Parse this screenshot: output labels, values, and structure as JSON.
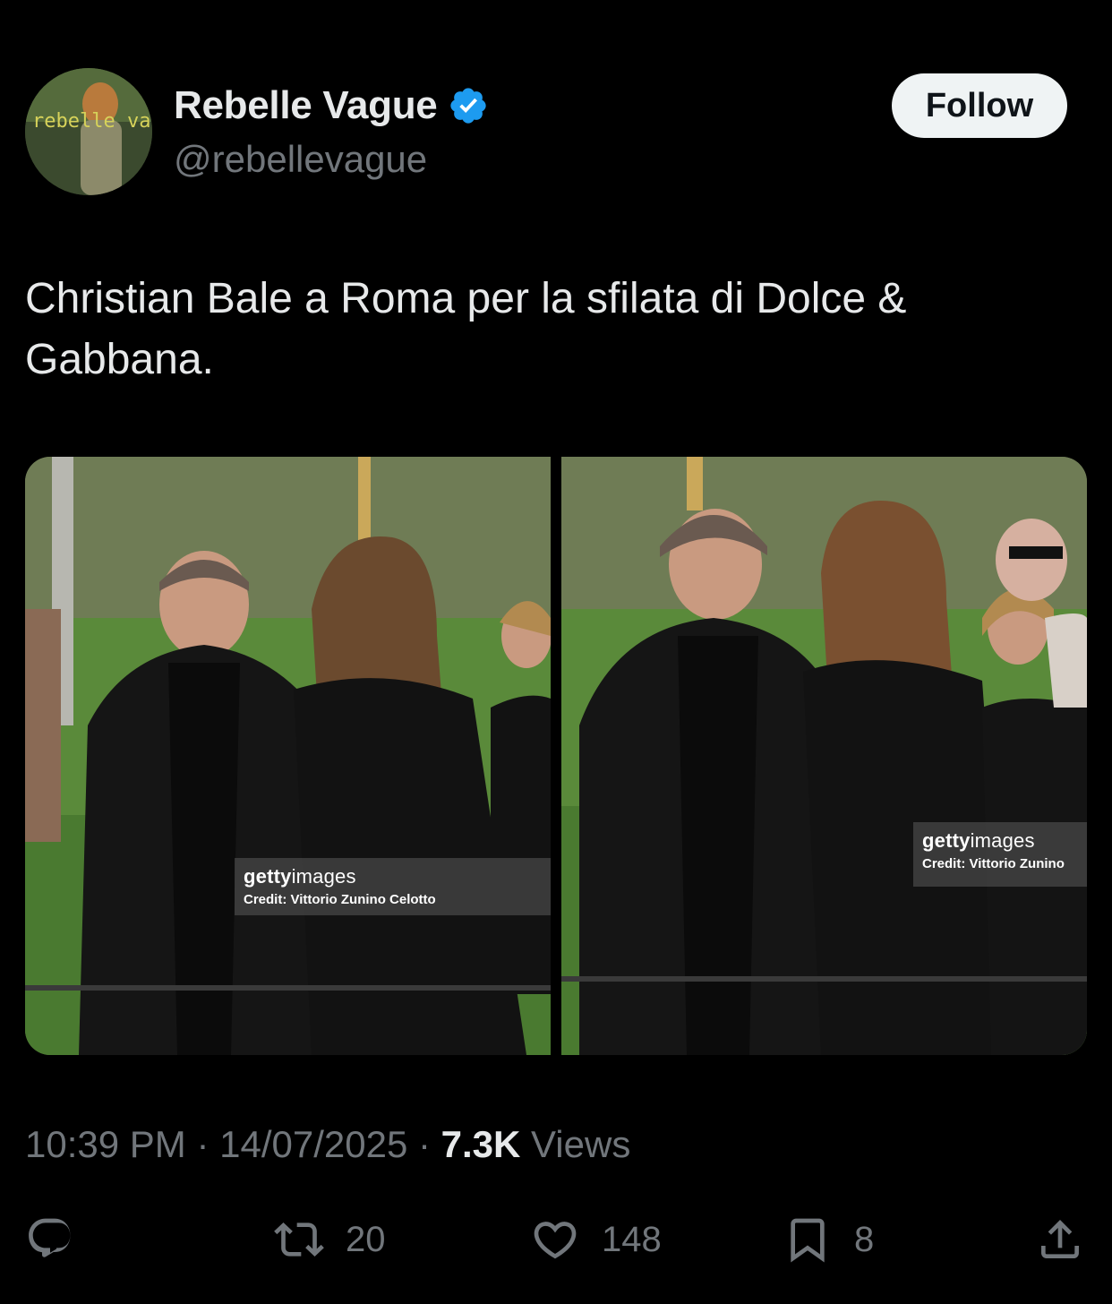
{
  "author": {
    "display_name": "Rebelle Vague",
    "handle": "@rebellevague",
    "avatar_text": "rebelle vague",
    "verified": true
  },
  "follow_label": "Follow",
  "tweet": {
    "text": "Christian Bale a Roma per la sfilata di Dolce & Gabbana."
  },
  "media": [
    {
      "watermark_brand_bold": "getty",
      "watermark_brand_thin": "images",
      "credit": "Credit: Vittorio Zunino Celotto"
    },
    {
      "watermark_brand_bold": "getty",
      "watermark_brand_thin": "images",
      "credit": "Credit: Vittorio Zunino"
    }
  ],
  "meta": {
    "time": "10:39 PM",
    "separator": " · ",
    "date": "14/07/2025",
    "views_count": "7.3K",
    "views_label": " Views"
  },
  "actions": {
    "reply_icon": "reply-icon",
    "retweet_count": "20",
    "like_count": "148",
    "bookmark_count": "8",
    "share_icon": "share-icon"
  },
  "colors": {
    "background": "#000000",
    "text_primary": "#e7e9ea",
    "text_secondary": "#71767b",
    "verified_blue": "#1d9bf0",
    "follow_bg": "#eff3f4"
  }
}
